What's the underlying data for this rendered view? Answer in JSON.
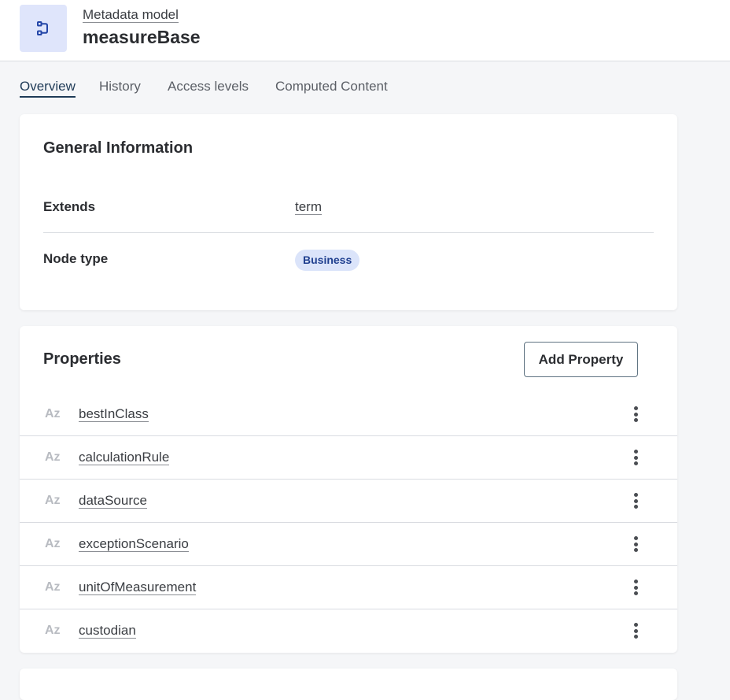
{
  "header": {
    "icon": "metadata-model-icon",
    "kind_label": "Metadata model",
    "title": "measureBase",
    "accent_color": "#2446a8",
    "icon_bg": "#dfe5fb"
  },
  "tabs": [
    {
      "label": "Overview",
      "active": true
    },
    {
      "label": "History",
      "active": false
    },
    {
      "label": "Access levels",
      "active": false
    },
    {
      "label": "Computed Content",
      "active": false
    }
  ],
  "general": {
    "title": "General Information",
    "extends_label": "Extends",
    "extends_value": "term",
    "node_type_label": "Node type",
    "node_type_value": "Business"
  },
  "properties": {
    "title": "Properties",
    "add_label": "Add Property",
    "items": [
      {
        "type": "Az",
        "name": "bestInClass"
      },
      {
        "type": "Az",
        "name": "calculationRule"
      },
      {
        "type": "Az",
        "name": "dataSource"
      },
      {
        "type": "Az",
        "name": "exceptionScenario"
      },
      {
        "type": "Az",
        "name": "unitOfMeasurement"
      },
      {
        "type": "Az",
        "name": "custodian"
      }
    ]
  }
}
